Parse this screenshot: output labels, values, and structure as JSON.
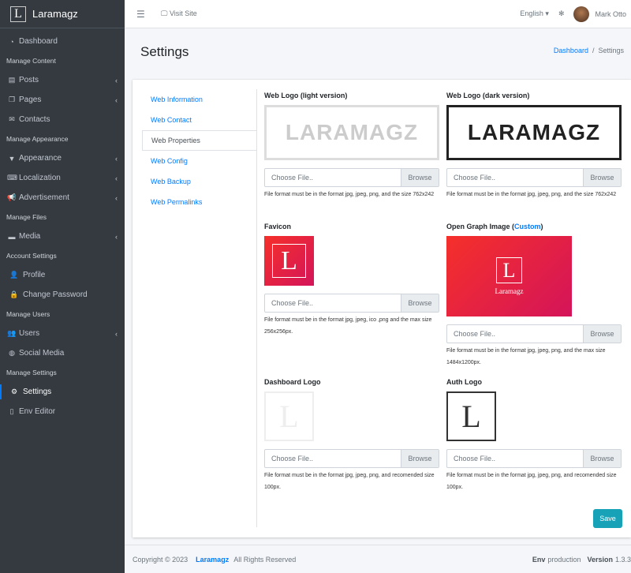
{
  "brand": {
    "name": "Laramagz",
    "logo_letter": "L"
  },
  "sidebar": {
    "items": [
      {
        "type": "item",
        "label": "Dashboard",
        "icon": "tachometer-icon",
        "ch": false
      },
      {
        "type": "header",
        "label": "Manage Content"
      },
      {
        "type": "item",
        "label": "Posts",
        "icon": "book-icon",
        "ch": true
      },
      {
        "type": "item",
        "label": "Pages",
        "icon": "copy-icon",
        "ch": true
      },
      {
        "type": "item",
        "label": "Contacts",
        "icon": "envelope-icon",
        "ch": false
      },
      {
        "type": "header",
        "label": "Manage Appearance"
      },
      {
        "type": "item",
        "label": "Appearance",
        "icon": "paint-roller-icon",
        "ch": true
      },
      {
        "type": "item",
        "label": "Localization",
        "icon": "language-icon",
        "ch": true
      },
      {
        "type": "item",
        "label": "Advertisement",
        "icon": "bullhorn-icon",
        "ch": true
      },
      {
        "type": "header",
        "label": "Manage Files"
      },
      {
        "type": "item",
        "label": "Media",
        "icon": "hdd-icon",
        "ch": true
      },
      {
        "type": "header",
        "label": "Account Settings"
      },
      {
        "type": "item",
        "label": "Profile",
        "icon": "user-icon",
        "ch": false,
        "sub": true
      },
      {
        "type": "item",
        "label": "Change Password",
        "icon": "lock-icon",
        "ch": false,
        "sub": true
      },
      {
        "type": "header",
        "label": "Manage Users"
      },
      {
        "type": "item",
        "label": "Users",
        "icon": "users-icon",
        "ch": true
      },
      {
        "type": "item",
        "label": "Social Media",
        "icon": "globe-icon",
        "ch": false
      },
      {
        "type": "header",
        "label": "Manage Settings"
      },
      {
        "type": "item",
        "label": "Settings",
        "icon": "cogs-icon",
        "ch": false,
        "sub": true,
        "active": true
      },
      {
        "type": "item",
        "label": "Env Editor",
        "icon": "file-icon",
        "ch": false
      }
    ]
  },
  "topbar": {
    "visit_site": "Visit Site",
    "language": "English",
    "user": "Mark Otto"
  },
  "page": {
    "title": "Settings",
    "breadcrumb": [
      "Dashboard",
      "Settings"
    ]
  },
  "tabs": [
    "Web Information",
    "Web Contact",
    "Web Properties",
    "Web Config",
    "Web Backup",
    "Web Permalinks"
  ],
  "active_tab": "Web Properties",
  "fields": {
    "logo_light": {
      "label": "Web Logo (light version)",
      "preview": "LARAMAGZ",
      "placeholder": "Choose File..",
      "browse": "Browse",
      "help": "File format must be in the format jpg, jpeg, png, and the size 762x242"
    },
    "logo_dark": {
      "label": "Web Logo (dark version)",
      "preview": "LARAMAGZ",
      "placeholder": "Choose File..",
      "browse": "Browse",
      "help": "File format must be in the format jpg, jpeg, png, and the size 762x242"
    },
    "favicon": {
      "label": "Favicon",
      "placeholder": "Choose File..",
      "browse": "Browse",
      "help": "File format must be in the format jpg, jpeg, ico ,png and the max size 256x256px."
    },
    "og": {
      "label": "Open Graph Image (",
      "link": "Custom",
      "label_end": ")",
      "preview_text": "Laramagz",
      "placeholder": "Choose File..",
      "browse": "Browse",
      "help": "File format must be in the format jpg, jpeg, png, and the max size 1484x1200px."
    },
    "dash_logo": {
      "label": "Dashboard Logo",
      "placeholder": "Choose File..",
      "browse": "Browse",
      "help": "File format must be in the format jpg, jpeg, png, and recomended size 100px."
    },
    "auth_logo": {
      "label": "Auth Logo",
      "placeholder": "Choose File..",
      "browse": "Browse",
      "help": "File format must be in the format jpg, jpeg, png, and recomended size 100px."
    }
  },
  "save_label": "Save",
  "footer": {
    "copyright": "Copyright © 2023",
    "brand": "Laramagz",
    "rights": "All Rights Reserved",
    "env_label": "Env",
    "env": "production",
    "version_label": "Version",
    "version": "1.3.3"
  },
  "colors": {
    "sidebar": "#343a40",
    "accent": "#007bff",
    "save": "#17a2b8"
  }
}
